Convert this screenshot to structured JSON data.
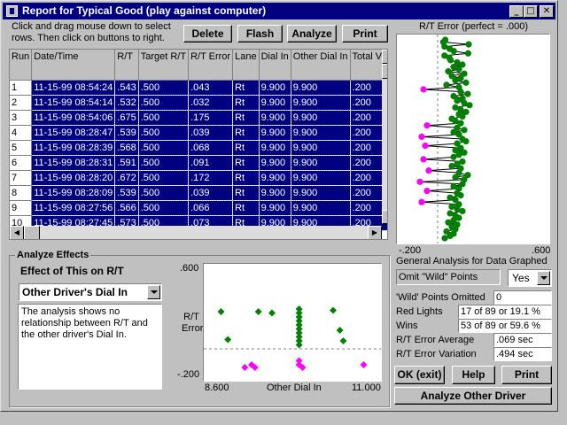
{
  "window": {
    "title": "Report for Typical Good (play against computer)"
  },
  "instructions": "Click and drag mouse down to select rows.  Then click on buttons to right.",
  "toolbar": {
    "delete": "Delete",
    "flash": "Flash",
    "analyze": "Analyze",
    "print": "Print"
  },
  "table": {
    "headers": [
      "Run",
      "Date/Time",
      "R/T",
      "Target R/T",
      "R/T Error",
      "Lane",
      "Dial In",
      "Other Dial In",
      "Total Veh"
    ],
    "rows": [
      [
        "1",
        "11-15-99 08:54:24",
        ".543",
        ".500",
        ".043",
        "Rt",
        "9.900",
        "9.900",
        ".200"
      ],
      [
        "2",
        "11-15-99 08:54:14",
        ".532",
        ".500",
        ".032",
        "Rt",
        "9.900",
        "9.900",
        ".200"
      ],
      [
        "3",
        "11-15-99 08:54:06",
        ".675",
        ".500",
        ".175",
        "Rt",
        "9.900",
        "9.900",
        ".200"
      ],
      [
        "4",
        "11-15-99 08:28:47",
        ".539",
        ".500",
        ".039",
        "Rt",
        "9.900",
        "9.900",
        ".200"
      ],
      [
        "5",
        "11-15-99 08:28:39",
        ".568",
        ".500",
        ".068",
        "Rt",
        "9.900",
        "9.900",
        ".200"
      ],
      [
        "6",
        "11-15-99 08:28:31",
        ".591",
        ".500",
        ".091",
        "Rt",
        "9.900",
        "9.900",
        ".200"
      ],
      [
        "7",
        "11-15-99 08:28:20",
        ".672",
        ".500",
        ".172",
        "Rt",
        "9.900",
        "9.900",
        ".200"
      ],
      [
        "8",
        "11-15-99 08:28:09",
        ".539",
        ".500",
        ".039",
        "Rt",
        "9.900",
        "9.900",
        ".200"
      ],
      [
        "9",
        "11-15-99 08:27:56",
        ".566",
        ".500",
        ".066",
        "Rt",
        "9.900",
        "9.900",
        ".200"
      ],
      [
        "10",
        "11-15-99 08:27:45",
        ".573",
        ".500",
        ".073",
        "Rt",
        "9.900",
        "9.900",
        ".200"
      ]
    ]
  },
  "rt_error_chart": {
    "title": "R/T Error (perfect = .000)",
    "x_min_label": "-.200",
    "x_max_label": ".600"
  },
  "general": {
    "heading": "General Analysis for Data Graphed",
    "omit_label": "Omit \"Wild\" Points",
    "omit_value": "Yes",
    "wild_label": "'Wild' Points Omitted",
    "wild_value": "0",
    "red_label": "Red Lights",
    "red_value": "17 of 89   or 19.1 %",
    "wins_label": "Wins",
    "wins_value": "53 of 89   or 59.6 %",
    "avg_label": "R/T Error Average",
    "avg_value": ".069 sec",
    "var_label": "R/T Error Variation",
    "var_value": ".494 sec"
  },
  "buttons": {
    "ok": "OK (exit)",
    "help": "Help",
    "print": "Print",
    "analyze_other": "Analyze Other Driver"
  },
  "effects": {
    "group_title": "Analyze Effects",
    "heading": "Effect of This on R/T",
    "factor": "Other Driver's Dial In",
    "description": "The analysis shows no relationship between R/T and the other driver's Dial In."
  },
  "chart_data": {
    "type": "scatter",
    "title": "",
    "xlabel": "Other Dial In",
    "ylabel": "R/T Error",
    "xlim": [
      8.6,
      11.0
    ],
    "ylim": [
      -0.2,
      0.6
    ],
    "x_tick_labels": [
      "8.600",
      "11.000"
    ],
    "y_tick_labels": [
      ".600",
      "-.200"
    ],
    "reference_line_y": 0.0,
    "colors": {
      "positive": "#008000",
      "negative": "#ff00ff",
      "reference": "#808080"
    },
    "points": [
      {
        "x": 8.75,
        "y": 0.28
      },
      {
        "x": 8.85,
        "y": 0.07
      },
      {
        "x": 9.3,
        "y": 0.28
      },
      {
        "x": 9.5,
        "y": 0.27
      },
      {
        "x": 9.9,
        "y": 0.3
      },
      {
        "x": 9.9,
        "y": 0.27
      },
      {
        "x": 9.9,
        "y": 0.24
      },
      {
        "x": 9.9,
        "y": 0.21
      },
      {
        "x": 9.9,
        "y": 0.18
      },
      {
        "x": 9.9,
        "y": 0.15
      },
      {
        "x": 9.9,
        "y": 0.12
      },
      {
        "x": 9.9,
        "y": 0.09
      },
      {
        "x": 9.9,
        "y": 0.06
      },
      {
        "x": 9.9,
        "y": 0.03
      },
      {
        "x": 10.4,
        "y": 0.29
      },
      {
        "x": 10.5,
        "y": 0.14
      },
      {
        "x": 10.55,
        "y": 0.06
      },
      {
        "x": 9.1,
        "y": -0.14
      },
      {
        "x": 9.2,
        "y": -0.12
      },
      {
        "x": 9.25,
        "y": -0.14
      },
      {
        "x": 9.9,
        "y": -0.09
      },
      {
        "x": 9.9,
        "y": -0.12
      },
      {
        "x": 9.95,
        "y": -0.14
      },
      {
        "x": 10.85,
        "y": -0.12
      }
    ]
  },
  "rt_strip_data": {
    "xlim": [
      -0.2,
      0.6
    ],
    "values": [
      0.043,
      0.032,
      0.175,
      0.039,
      0.068,
      0.091,
      0.172,
      0.039,
      0.066,
      0.073,
      0.11,
      0.14,
      0.09,
      0.12,
      0.06,
      0.15,
      0.08,
      0.13,
      0.1,
      0.16,
      0.05,
      0.12,
      -0.08,
      0.13,
      0.17,
      0.09,
      0.14,
      0.11,
      0.15,
      0.18,
      0.1,
      0.13,
      0.16,
      0.12,
      0.14,
      0.08,
      0.1,
      0.13,
      -0.06,
      0.11,
      0.15,
      0.09,
      0.12,
      -0.09,
      0.14,
      0.16,
      0.11,
      -0.07,
      0.13,
      0.1,
      0.15,
      0.12,
      0.09,
      -0.08,
      0.14,
      0.11,
      0.08,
      0.13,
      -0.05,
      0.12,
      0.17,
      0.1,
      0.15,
      -0.1,
      0.14,
      0.09,
      0.12,
      -0.06,
      0.11,
      0.13,
      0.07,
      0.1,
      -0.09,
      0.12,
      0.08,
      0.11,
      0.14,
      0.07,
      0.1,
      0.12,
      0.09,
      0.06,
      0.11,
      0.08,
      0.1,
      0.05,
      0.09,
      0.07,
      0.04
    ]
  }
}
